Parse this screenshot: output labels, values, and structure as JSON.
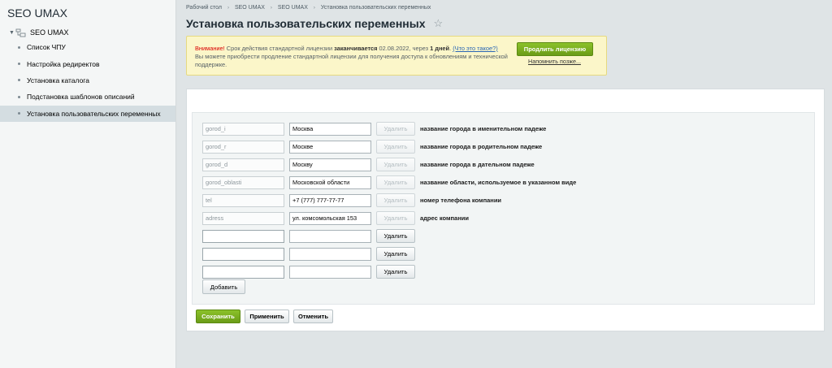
{
  "sidebar": {
    "title": "SEO UMAX",
    "root": {
      "label": "SEO UMAX",
      "icon": "folder-tree-icon"
    },
    "items": [
      {
        "label": "Список ЧПУ",
        "active": false
      },
      {
        "label": "Настройка редиректов",
        "active": false
      },
      {
        "label": "Установка каталога",
        "active": false
      },
      {
        "label": "Подстановка шаблонов описаний",
        "active": false
      },
      {
        "label": "Установка пользовательских переменных",
        "active": true
      }
    ]
  },
  "breadcrumb": [
    "Рабочий стол",
    "SEO UMAX",
    "SEO UMAX",
    "Установка пользовательских переменных"
  ],
  "page": {
    "title": "Установка пользовательских переменных",
    "star_icon": "star-icon"
  },
  "notice": {
    "warning": "Внимание!",
    "text1": " Срок действия стандартной лицензии ",
    "expires": "заканчивается",
    "text2": " 02.08.2022, через ",
    "days": "1 дней",
    "text3": ". ",
    "whats_this": "(Что это такое?)",
    "line2": "Вы можете приобрести продление стандартной лицензии для получения доступа к обновлениям и технической поддержке.",
    "renew_button": "Продлить лицензию",
    "remind_link": "Напомнить позже..."
  },
  "variables": [
    {
      "key": "gorod_i",
      "value": "Москва",
      "delete": "Удалить",
      "desc": "название города в именительном падеже"
    },
    {
      "key": "gorod_r",
      "value": "Москве",
      "delete": "Удалить",
      "desc": "название города в родительном падеже"
    },
    {
      "key": "gorod_d",
      "value": "Москву",
      "delete": "Удалить",
      "desc": "название города в дательном падеже"
    },
    {
      "key": "gorod_oblasti",
      "value": "Московской области",
      "delete": "Удалить",
      "desc": "название области, используемое в указанном виде"
    },
    {
      "key": "tel",
      "value": "+7 (777) 777-77-77",
      "delete": "Удалить",
      "desc": "номер телефона компании"
    },
    {
      "key": "adress",
      "value": "ул. комсомольская 153",
      "delete": "Удалить",
      "desc": "адрес компании"
    },
    {
      "key": "",
      "value": "",
      "delete": "Удалить",
      "desc": ""
    },
    {
      "key": "",
      "value": "",
      "delete": "Удалить",
      "desc": ""
    },
    {
      "key": "",
      "value": "",
      "delete": "Удалить",
      "desc": ""
    }
  ],
  "buttons": {
    "add": "Добавить",
    "save": "Сохранить",
    "apply": "Применить",
    "cancel": "Отменить"
  },
  "colors": {
    "accent_green": "#7aab1f",
    "notice_bg": "#fbf6c9",
    "warning_red": "#d90000"
  }
}
